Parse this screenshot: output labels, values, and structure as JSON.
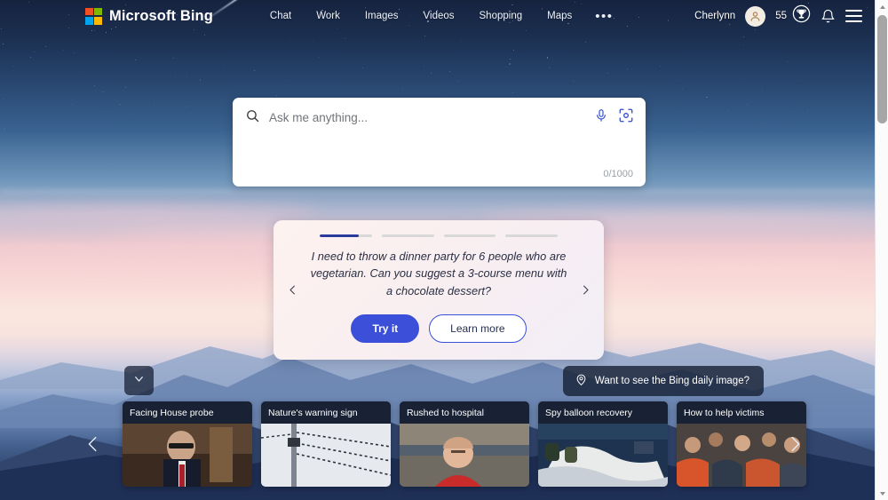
{
  "header": {
    "brand": "Microsoft Bing",
    "logo_icon": "microsoft-squares-logo",
    "logo_colors": [
      "#f25022",
      "#7fba00",
      "#00a4ef",
      "#ffb900"
    ],
    "nav": [
      {
        "label": "Chat",
        "name": "chat"
      },
      {
        "label": "Work",
        "name": "work"
      },
      {
        "label": "Images",
        "name": "images"
      },
      {
        "label": "Videos",
        "name": "videos"
      },
      {
        "label": "Shopping",
        "name": "shopping"
      },
      {
        "label": "Maps",
        "name": "maps"
      }
    ],
    "more_label": "•••",
    "more_icon": "ellipsis-icon",
    "user_name": "Cherlynn",
    "avatar_icon": "person-avatar-icon",
    "rewards_count": "55",
    "rewards_icon": "trophy-rewards-icon",
    "notifications_icon": "bell-icon",
    "menu_icon": "hamburger-menu-icon"
  },
  "search": {
    "placeholder": "Ask me anything...",
    "value": "",
    "search_icon": "search-icon",
    "mic_icon": "microphone-icon",
    "visual_icon": "visual-search-camera-icon",
    "counter": "0/1000"
  },
  "suggestion": {
    "prompt": "I need to throw a dinner party for 6 people who are vegetarian. Can you suggest a 3-course menu with a chocolate dessert?",
    "try_label": "Try it",
    "learn_label": "Learn more",
    "prev_icon": "chevron-left-icon",
    "next_icon": "chevron-right-icon",
    "accent_color": "#3b4fd8",
    "progress": [
      75,
      0,
      0,
      0
    ]
  },
  "daily_image": {
    "label": "Want to see the Bing daily image?",
    "icon": "location-pin-icon"
  },
  "collapse": {
    "icon": "chevron-down-icon"
  },
  "news": {
    "prev_icon": "chevron-left-icon",
    "next_icon": "chevron-right-icon",
    "cards": [
      {
        "title": "Facing House probe"
      },
      {
        "title": "Nature's warning sign"
      },
      {
        "title": "Rushed to hospital"
      },
      {
        "title": "Spy balloon recovery"
      },
      {
        "title": "How to help victims"
      }
    ]
  },
  "scrollbar": {
    "up_icon": "scroll-up-arrow-icon",
    "down_icon": "scroll-down-arrow-icon"
  }
}
